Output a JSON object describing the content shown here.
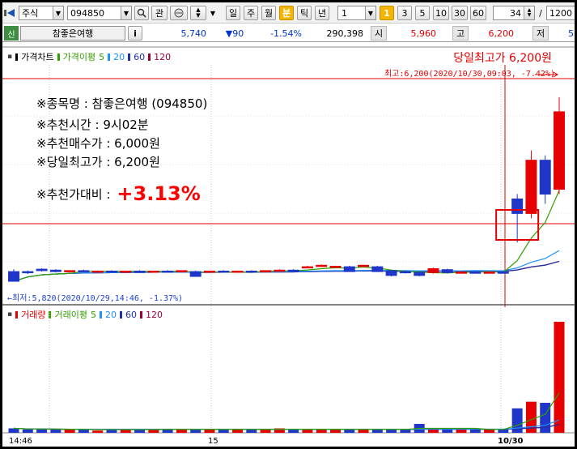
{
  "toolbar": {
    "market": "주식",
    "code": "094850",
    "btn_gwan": "관",
    "periods": [
      "일",
      "주",
      "월",
      "분",
      "틱",
      "년"
    ],
    "selected_period": "분",
    "interval_value": "1",
    "intervals": [
      "1",
      "3",
      "5",
      "10",
      "30",
      "60"
    ],
    "selected_interval": "1",
    "count_value": "34",
    "slash": "/",
    "total_value": "1200"
  },
  "quote": {
    "badge": "신",
    "name": "참좋은여행",
    "info_btn": "i",
    "price": "5,740",
    "change": "▼90",
    "change_pct": "-1.54%",
    "volume": "290,398",
    "open_label": "시",
    "open": "5,960",
    "high_label": "고",
    "high": "6,200",
    "low_label": "저",
    "low_value": "5"
  },
  "price_legend": {
    "title": "가격차트",
    "ma_title": "가격이평",
    "ma_periods": [
      "5",
      "20",
      "60",
      "120"
    ]
  },
  "volume_legend": {
    "title": "거래량",
    "ma_title": "거래이평",
    "ma_periods": [
      "5",
      "20",
      "60",
      "120"
    ]
  },
  "headline": "당일최고가 6,200원",
  "max_label": "최고:6,200(2020/10/30,09:03, -7.42%)",
  "min_label": "←최저:5,820(2020/10/29,14:46, -1.37%)",
  "notes": {
    "n1": "※종목명 : 참좋은여행 (094850)",
    "n2": "※추천시간 : 9시02분",
    "n3": "※추천매수가 : 6,000원",
    "n4": "※당일최고가 : 6,200원",
    "n5_label": "※추천가대비 :",
    "n5_value": "+3.13%"
  },
  "x_axis": [
    "14:46",
    "15",
    "10/30"
  ],
  "colors": {
    "up": "#e60000",
    "down": "#1f36c8",
    "ma5": "#33a000",
    "ma20": "#1e90ff",
    "ma60": "#1f2fa8",
    "ma120": "#990033",
    "highlight": "#e00000"
  },
  "chart_data": {
    "type": "candlestick",
    "price_range": [
      5800,
      6200
    ],
    "candles": [
      {
        "o": 5840,
        "h": 5845,
        "l": 5820,
        "c": 5820
      },
      {
        "o": 5840,
        "h": 5842,
        "l": 5835,
        "c": 5838
      },
      {
        "o": 5845,
        "h": 5847,
        "l": 5840,
        "c": 5842
      },
      {
        "o": 5843,
        "h": 5845,
        "l": 5838,
        "c": 5840
      },
      {
        "o": 5840,
        "h": 5843,
        "l": 5838,
        "c": 5842
      },
      {
        "o": 5842,
        "h": 5844,
        "l": 5840,
        "c": 5840
      },
      {
        "o": 5840,
        "h": 5842,
        "l": 5838,
        "c": 5841
      },
      {
        "o": 5841,
        "h": 5843,
        "l": 5839,
        "c": 5840
      },
      {
        "o": 5840,
        "h": 5842,
        "l": 5838,
        "c": 5841
      },
      {
        "o": 5841,
        "h": 5843,
        "l": 5839,
        "c": 5840
      },
      {
        "o": 5840,
        "h": 5842,
        "l": 5838,
        "c": 5841
      },
      {
        "o": 5841,
        "h": 5843,
        "l": 5839,
        "c": 5840
      },
      {
        "o": 5840,
        "h": 5842,
        "l": 5838,
        "c": 5842
      },
      {
        "o": 5840,
        "h": 5842,
        "l": 5830,
        "c": 5830
      },
      {
        "o": 5840,
        "h": 5842,
        "l": 5838,
        "c": 5841
      },
      {
        "o": 5841,
        "h": 5843,
        "l": 5839,
        "c": 5840
      },
      {
        "o": 5840,
        "h": 5842,
        "l": 5838,
        "c": 5841
      },
      {
        "o": 5841,
        "h": 5843,
        "l": 5839,
        "c": 5840
      },
      {
        "o": 5840,
        "h": 5842,
        "l": 5838,
        "c": 5842
      },
      {
        "o": 5842,
        "h": 5845,
        "l": 5840,
        "c": 5843
      },
      {
        "o": 5843,
        "h": 5845,
        "l": 5841,
        "c": 5842
      },
      {
        "o": 5850,
        "h": 5852,
        "l": 5848,
        "c": 5850
      },
      {
        "o": 5852,
        "h": 5855,
        "l": 5850,
        "c": 5853
      },
      {
        "o": 5850,
        "h": 5852,
        "l": 5848,
        "c": 5851
      },
      {
        "o": 5850,
        "h": 5852,
        "l": 5840,
        "c": 5840
      },
      {
        "o": 5852,
        "h": 5854,
        "l": 5850,
        "c": 5853
      },
      {
        "o": 5850,
        "h": 5852,
        "l": 5840,
        "c": 5840
      },
      {
        "o": 5842,
        "h": 5844,
        "l": 5830,
        "c": 5832
      },
      {
        "o": 5840,
        "h": 5842,
        "l": 5836,
        "c": 5838
      },
      {
        "o": 5838,
        "h": 5840,
        "l": 5830,
        "c": 5832
      },
      {
        "o": 5838,
        "h": 5848,
        "l": 5836,
        "c": 5846
      },
      {
        "o": 5844,
        "h": 5846,
        "l": 5836,
        "c": 5838
      },
      {
        "o": 5838,
        "h": 5840,
        "l": 5836,
        "c": 5839
      },
      {
        "o": 5839,
        "h": 5841,
        "l": 5837,
        "c": 5838
      },
      {
        "o": 5838,
        "h": 5840,
        "l": 5836,
        "c": 5839
      },
      {
        "o": 5839,
        "h": 5841,
        "l": 5837,
        "c": 5838
      },
      {
        "o": 5990,
        "h": 6000,
        "l": 5900,
        "c": 5960
      },
      {
        "o": 5960,
        "h": 6090,
        "l": 5950,
        "c": 6070
      },
      {
        "o": 6070,
        "h": 6080,
        "l": 5980,
        "c": 6000
      },
      {
        "o": 6010,
        "h": 6200,
        "l": 6000,
        "c": 6170
      }
    ],
    "volumes": [
      4,
      3,
      3,
      3,
      3,
      3,
      2,
      3,
      3,
      3,
      3,
      3,
      3,
      3,
      3,
      3,
      3,
      3,
      3,
      4,
      3,
      3,
      3,
      3,
      3,
      3,
      3,
      3,
      3,
      8,
      3,
      3,
      3,
      3,
      3,
      3,
      22,
      28,
      27,
      100
    ],
    "volume_range": [
      0,
      100
    ]
  }
}
